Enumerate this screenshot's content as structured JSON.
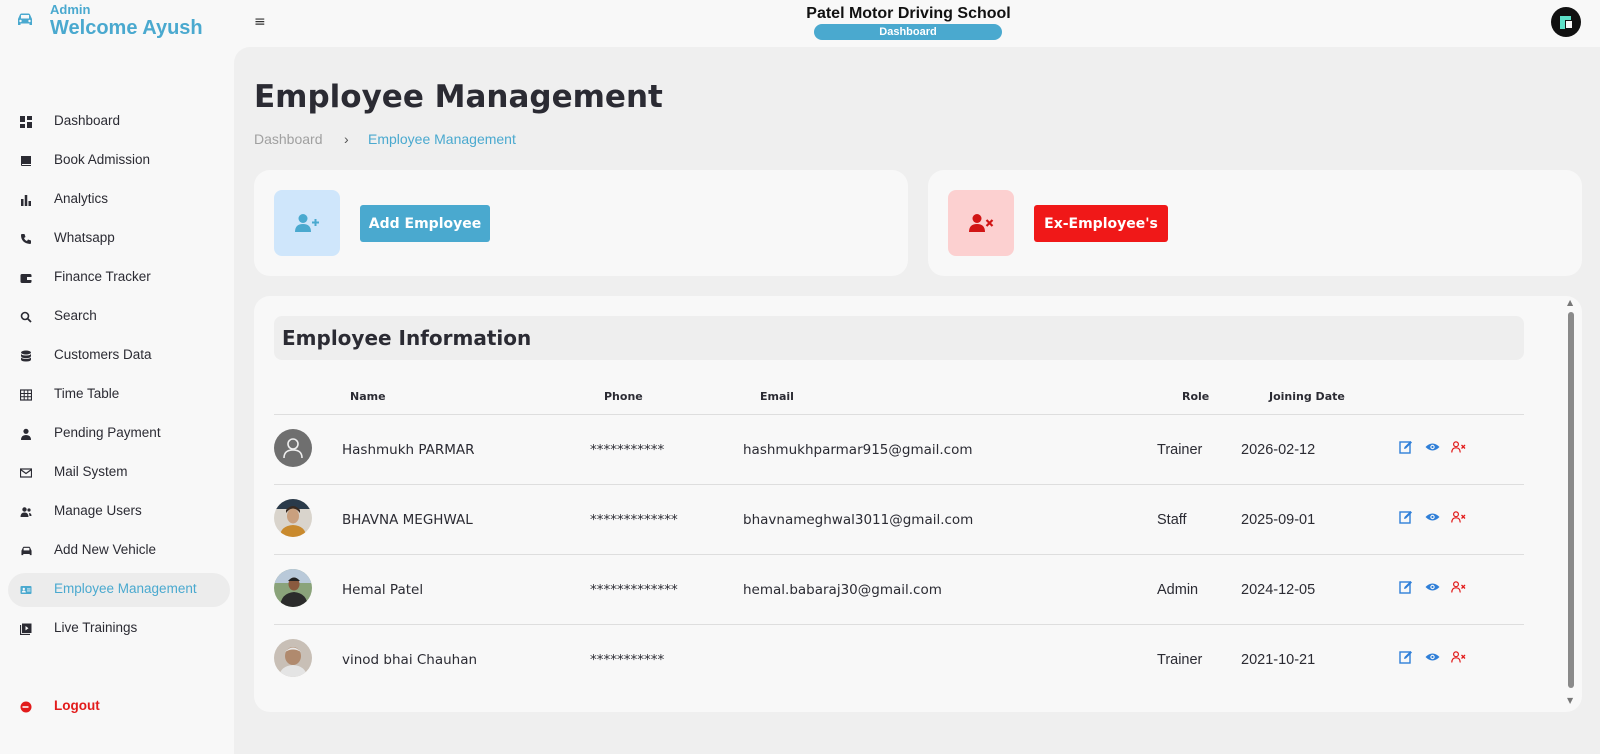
{
  "brand": {
    "role": "Admin",
    "welcome": "Welcome Ayush"
  },
  "header": {
    "menu_icon": "≡",
    "app_title": "Patel Motor Driving School",
    "pill_label": "Dashboard"
  },
  "sidebar": {
    "items": [
      {
        "label": "Dashboard",
        "icon": "grid-icon"
      },
      {
        "label": "Book Admission",
        "icon": "book-icon"
      },
      {
        "label": "Analytics",
        "icon": "bar-chart-icon"
      },
      {
        "label": "Whatsapp",
        "icon": "phone-icon"
      },
      {
        "label": "Finance Tracker",
        "icon": "wallet-icon"
      },
      {
        "label": "Search",
        "icon": "search-icon"
      },
      {
        "label": "Customers Data",
        "icon": "database-icon"
      },
      {
        "label": "Time Table",
        "icon": "table-icon"
      },
      {
        "label": "Pending Payment",
        "icon": "person-icon"
      },
      {
        "label": "Mail System",
        "icon": "mail-icon"
      },
      {
        "label": "Manage Users",
        "icon": "users-icon"
      },
      {
        "label": "Add New Vehicle",
        "icon": "car-icon"
      },
      {
        "label": "Employee Management",
        "icon": "id-card-icon",
        "active": true
      },
      {
        "label": "Live Trainings",
        "icon": "video-icon"
      }
    ],
    "logout": "Logout"
  },
  "page": {
    "title": "Employee Management",
    "breadcrumb": {
      "home": "Dashboard",
      "separator": "›",
      "current": "Employee Management"
    }
  },
  "actions": {
    "add_label": "Add Employee",
    "ex_label": "Ex-Employee's"
  },
  "table": {
    "heading": "Employee Information",
    "columns": {
      "name": "Name",
      "phone": "Phone",
      "email": "Email",
      "role": "Role",
      "date": "Joining Date"
    },
    "rows": [
      {
        "name": "Hashmukh PARMAR",
        "phone": "***********",
        "email": "hashmukhparmar915@gmail.com",
        "role": "Trainer",
        "date": "2026-02-12"
      },
      {
        "name": "BHAVNA MEGHWAL",
        "phone": "*************",
        "email": "bhavnameghwal3011@gmail.com",
        "role": "Staff",
        "date": "2025-09-01"
      },
      {
        "name": "Hemal Patel",
        "phone": "*************",
        "email": "hemal.babaraj30@gmail.com",
        "role": "Admin",
        "date": "2024-12-05"
      },
      {
        "name": "vinod bhai Chauhan",
        "phone": "***********",
        "email": "",
        "role": "Trainer",
        "date": "2021-10-21"
      }
    ]
  },
  "colors": {
    "accent": "#4aa9cf",
    "danger": "#f01818",
    "text": "#2b2b33"
  }
}
